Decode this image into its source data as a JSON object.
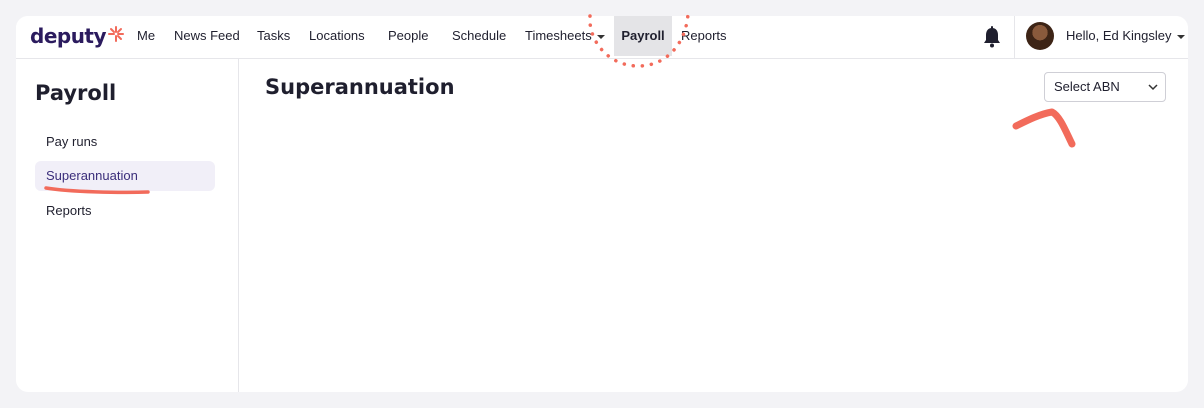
{
  "brand": {
    "logo_text": "deputy"
  },
  "nav": {
    "items": [
      {
        "label": "Me"
      },
      {
        "label": "News Feed"
      },
      {
        "label": "Tasks"
      },
      {
        "label": "Locations"
      },
      {
        "label": "People"
      },
      {
        "label": "Schedule"
      },
      {
        "label": "Timesheets",
        "has_dropdown": true
      },
      {
        "label": "Payroll",
        "active": true
      },
      {
        "label": "Reports"
      }
    ]
  },
  "header": {
    "notification_icon": "bell-icon",
    "greeting": "Hello, Ed Kingsley"
  },
  "sidebar": {
    "title": "Payroll",
    "items": [
      {
        "label": "Pay runs"
      },
      {
        "label": "Superannuation",
        "active": true
      },
      {
        "label": "Reports"
      }
    ]
  },
  "main": {
    "title": "Superannuation",
    "abn_select": {
      "value": "Select ABN"
    }
  },
  "colors": {
    "brand": "#2b1b5e",
    "accent": "#f26b5b",
    "active_nav_bg": "#e4e4e7",
    "active_side_bg": "#f1eff8",
    "annotation": "#f26b5b"
  }
}
